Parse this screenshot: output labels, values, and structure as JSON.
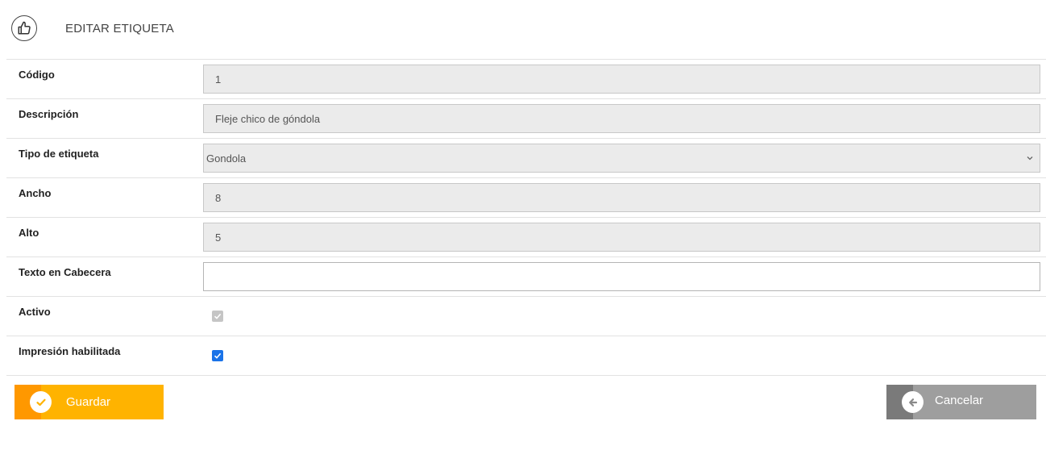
{
  "header": {
    "icon": "thumbs-up-icon",
    "title": "EDITAR ETIQUETA"
  },
  "form": {
    "codigo": {
      "label": "Código",
      "value": "1"
    },
    "descripcion": {
      "label": "Descripción",
      "value": "Fleje chico de góndola"
    },
    "tipo": {
      "label": "Tipo de etiqueta",
      "value": "Gondola"
    },
    "ancho": {
      "label": "Ancho",
      "value": "8"
    },
    "alto": {
      "label": "Alto",
      "value": "5"
    },
    "texto_cabecera": {
      "label": "Texto en Cabecera",
      "value": ""
    },
    "activo": {
      "label": "Activo",
      "checked": true,
      "disabled": true
    },
    "impresion": {
      "label": "Impresión habilitada",
      "checked": true,
      "disabled": false
    }
  },
  "actions": {
    "save_label": "Guardar",
    "cancel_label": "Cancelar"
  },
  "colors": {
    "save_primary": "#ffb300",
    "save_accent": "#ff9800",
    "cancel_primary": "#9e9e9e",
    "cancel_accent": "#7a7a7a",
    "checkbox_enabled": "#1a73e8",
    "checkbox_disabled": "#c5c5c5"
  }
}
